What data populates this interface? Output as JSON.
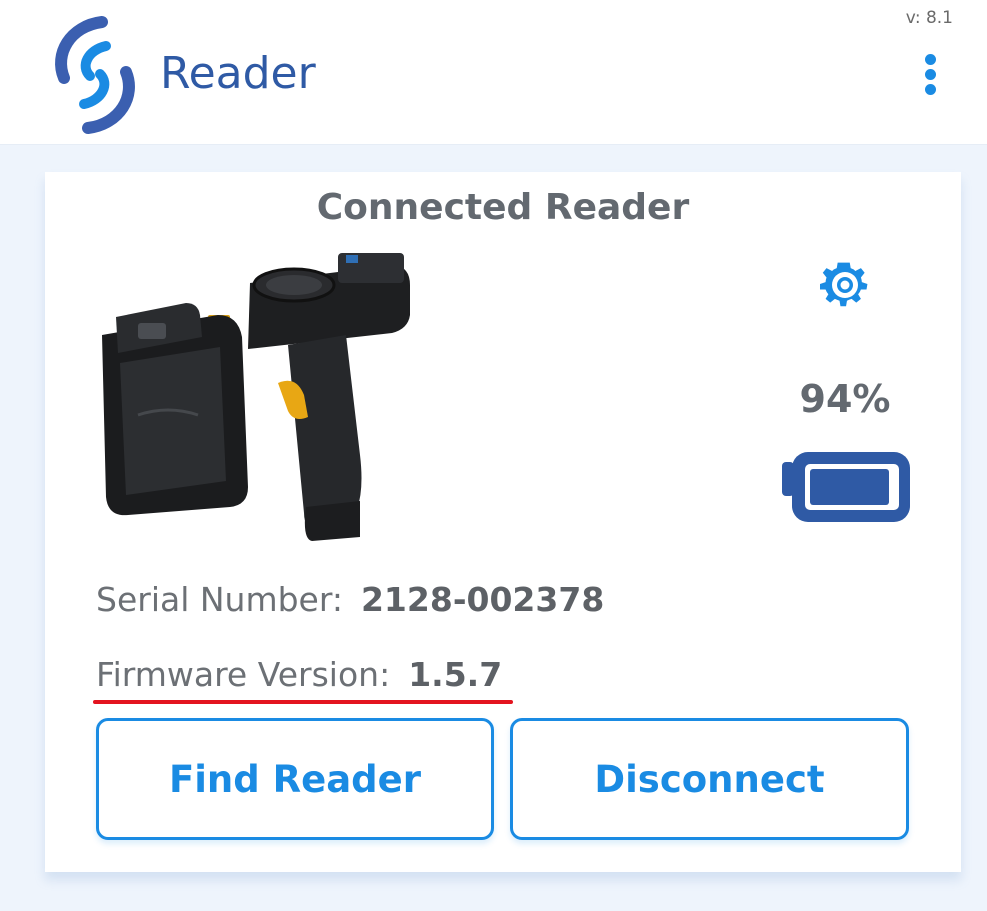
{
  "header": {
    "title": "Reader",
    "version": "v: 8.1",
    "logo_icon": "s-swirl-logo-icon",
    "menu_icon": "vertical-dots-menu-icon"
  },
  "card": {
    "title": "Connected Reader",
    "reader_image": "handheld-rfid-reader-image",
    "settings_icon": "gear-icon",
    "battery": {
      "percent_label": "94%",
      "level": 0.94,
      "icon": "battery-icon"
    },
    "serial": {
      "label": "Serial Number:",
      "value": "2128-002378"
    },
    "firmware": {
      "label": "Firmware Version:",
      "value": "1.5.7"
    },
    "buttons": {
      "find_label": "Find Reader",
      "disconnect_label": "Disconnect"
    }
  },
  "colors": {
    "brand_blue": "#2f5aa5",
    "accent_blue": "#1a8be3",
    "text_gray": "#636970",
    "highlight_red": "#e3141f",
    "background": "#eef4fc"
  }
}
